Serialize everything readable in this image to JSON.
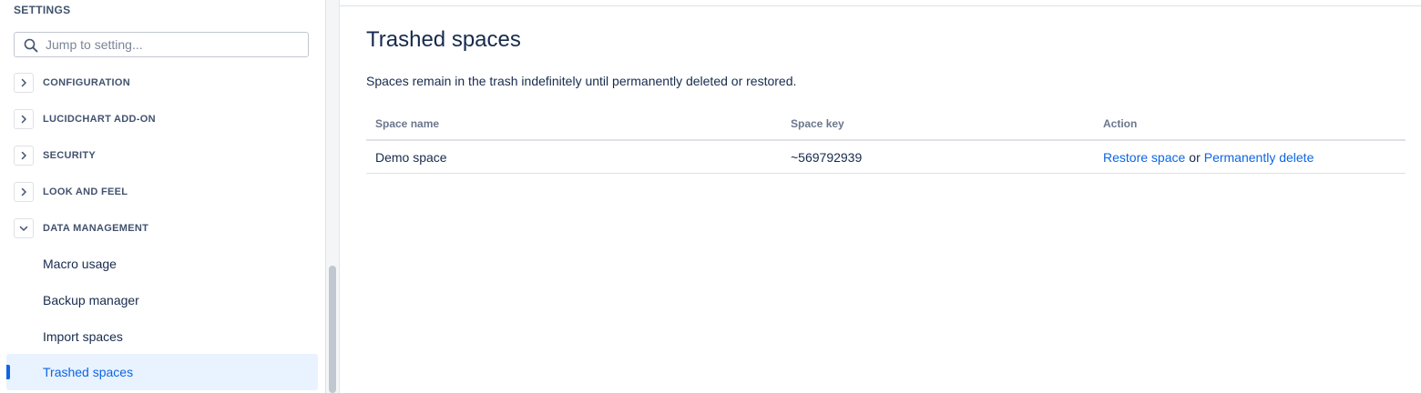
{
  "sidebar": {
    "heading": "SETTINGS",
    "search": {
      "placeholder": "Jump to setting...",
      "value": ""
    },
    "sections": [
      {
        "label": "CONFIGURATION",
        "expanded": false
      },
      {
        "label": "LUCIDCHART ADD-ON",
        "expanded": false
      },
      {
        "label": "SECURITY",
        "expanded": false
      },
      {
        "label": "LOOK AND FEEL",
        "expanded": false
      },
      {
        "label": "DATA MANAGEMENT",
        "expanded": true
      }
    ],
    "items": [
      {
        "label": "Macro usage",
        "active": false
      },
      {
        "label": "Backup manager",
        "active": false
      },
      {
        "label": "Import spaces",
        "active": false
      },
      {
        "label": "Trashed spaces",
        "active": true
      }
    ]
  },
  "main": {
    "title": "Trashed spaces",
    "description": "Spaces remain in the trash indefinitely until permanently deleted or restored.",
    "table": {
      "headers": [
        "Space name",
        "Space key",
        "Action"
      ],
      "rows": [
        {
          "name": "Demo space",
          "key": "~569792939",
          "restore_label": "Restore space",
          "separator": "or",
          "delete_label": "Permanently delete"
        }
      ]
    }
  },
  "colors": {
    "link": "#0c66e4",
    "active_bg": "#e9f2ff",
    "text": "#172b4d",
    "subtle_text": "#6b778c"
  },
  "icons": {
    "search": "search-icon",
    "collapsed": "chevron-right-icon",
    "expanded": "chevron-down-icon"
  }
}
